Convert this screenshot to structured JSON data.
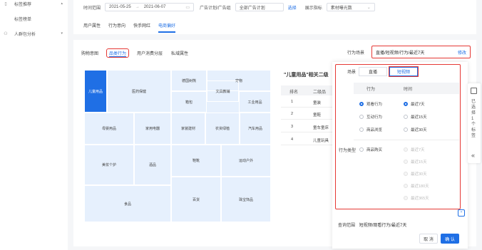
{
  "sidebar": {
    "items": [
      {
        "label": "标签推荐",
        "icon": "tag-icon",
        "arrow": "▴"
      },
      {
        "label": "标签榜单",
        "icon": "",
        "arrow": ""
      },
      {
        "label": "人群包分析",
        "icon": "people-icon",
        "arrow": "▾"
      }
    ]
  },
  "filters": {
    "time_label": "时间范围",
    "date_start": "2021-05-25",
    "date_sep": "→",
    "date_end": "2021-06-07",
    "plan_label": "广告计划/广告组",
    "plan_value": "全部广告计划",
    "select_link": "选择",
    "metric_label": "展示指标",
    "metric_value": "素材曝光数"
  },
  "tabs": [
    "用户属性",
    "行为意向",
    "快手网红",
    "电商偏好"
  ],
  "subtabs": [
    "购物意图",
    "品类行为",
    "用户消费分层",
    "私域属性"
  ],
  "scene": {
    "label": "行为场景",
    "value": "直播/短视频/行为/最近7天",
    "edit": "修改"
  },
  "treemap": {
    "cells": [
      {
        "label": "儿童用品",
        "selected": true
      },
      {
        "label": "医药保健"
      },
      {
        "label": "德国树熊"
      },
      {
        "label": "宠物"
      },
      {
        "label": "箱包"
      },
      {
        "label": "文具教辅"
      },
      {
        "label": "工业用品"
      },
      {
        "label": "母婴用品"
      },
      {
        "label": "家用电器"
      },
      {
        "label": "家装建材"
      },
      {
        "label": "农资绿植"
      },
      {
        "label": "汽车用品"
      },
      {
        "label": "美妆个护"
      },
      {
        "label": "酒品"
      },
      {
        "label": "鞋靴"
      },
      {
        "label": "运动户外"
      },
      {
        "label": "百货"
      },
      {
        "label": "珠宝饰品"
      },
      {
        "label": "食品"
      }
    ]
  },
  "ranking": {
    "title": "\"儿童用品\"相关二级",
    "headers": [
      "排名",
      "二级品"
    ],
    "rows": [
      {
        "rank": "1",
        "name": "童装"
      },
      {
        "rank": "2",
        "name": "童鞋"
      },
      {
        "rank": "3",
        "name": "童车童床"
      },
      {
        "rank": "4",
        "name": "儿童玩具"
      }
    ]
  },
  "panel": {
    "scene_label": "场景",
    "scene_options": [
      "直播",
      "短视频"
    ],
    "col_behavior": "行为",
    "col_time": "时间",
    "behavior_type_label": "行为类型",
    "options_top": [
      {
        "label": "观看行为",
        "on": true
      },
      {
        "label": "互动行为",
        "on": false
      },
      {
        "label": "商品浏览",
        "on": false
      }
    ],
    "times_top": [
      {
        "label": "最近7天",
        "on": true
      },
      {
        "label": "最近15天",
        "on": false
      },
      {
        "label": "最近30天",
        "on": false
      }
    ],
    "option_bottom": {
      "label": "商品购买"
    },
    "times_bottom": [
      "最近7天",
      "最近15天",
      "最近30天",
      "最近180天",
      "最近365天"
    ],
    "range_label": "查询范围",
    "range_value": "短视频/观看行为/最近7天",
    "cancel": "取 消",
    "confirm": "确 认"
  },
  "right_bar": {
    "text": "已选择1个标签"
  },
  "colors": {
    "accent": "#1f6fe5",
    "highlight_red": "#e53935"
  }
}
